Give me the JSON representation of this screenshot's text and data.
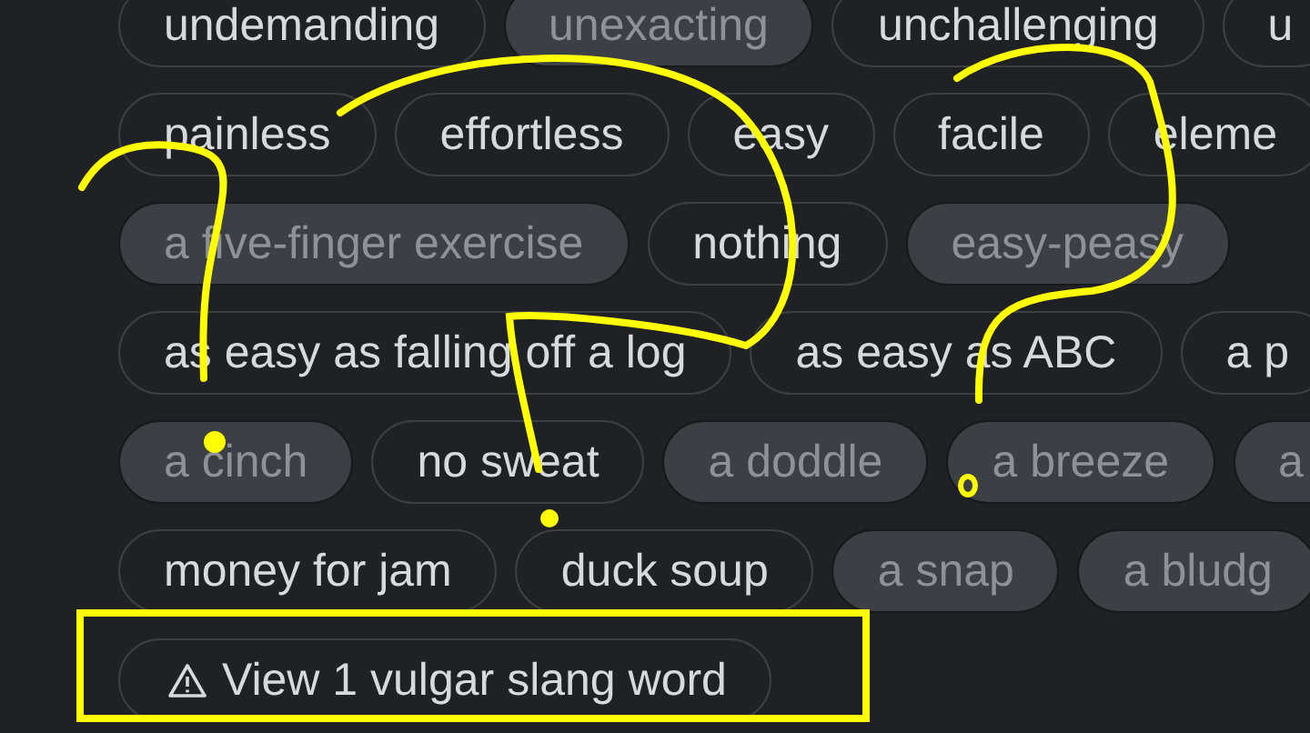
{
  "rows": [
    {
      "chips": [
        {
          "label": "undemanding",
          "kind": "outlined"
        },
        {
          "label": "unexacting",
          "kind": "muted"
        },
        {
          "label": "unchallenging",
          "kind": "outlined"
        },
        {
          "label": "u",
          "kind": "outlined"
        }
      ]
    },
    {
      "chips": [
        {
          "label": "painless",
          "kind": "outlined"
        },
        {
          "label": "effortless",
          "kind": "outlined"
        },
        {
          "label": "easy",
          "kind": "outlined"
        },
        {
          "label": "facile",
          "kind": "outlined"
        },
        {
          "label": "eleme",
          "kind": "outlined"
        }
      ]
    },
    {
      "chips": [
        {
          "label": "a five-finger exercise",
          "kind": "muted"
        },
        {
          "label": "nothing",
          "kind": "outlined"
        },
        {
          "label": "easy-peasy",
          "kind": "muted"
        }
      ]
    },
    {
      "chips": [
        {
          "label": "as easy as falling off a log",
          "kind": "outlined"
        },
        {
          "label": "as easy as ABC",
          "kind": "outlined"
        },
        {
          "label": "a p",
          "kind": "outlined"
        }
      ]
    },
    {
      "chips": [
        {
          "label": "a cinch",
          "kind": "muted"
        },
        {
          "label": "no sweat",
          "kind": "outlined"
        },
        {
          "label": "a doddle",
          "kind": "muted"
        },
        {
          "label": "a breeze",
          "kind": "muted"
        },
        {
          "label": "a",
          "kind": "muted"
        }
      ]
    },
    {
      "chips": [
        {
          "label": "money for jam",
          "kind": "outlined"
        },
        {
          "label": "duck soup",
          "kind": "outlined"
        },
        {
          "label": "a snap",
          "kind": "muted"
        },
        {
          "label": "a bludg",
          "kind": "muted"
        }
      ]
    }
  ],
  "vulgar_button": {
    "label": "View 1 vulgar slang word"
  }
}
